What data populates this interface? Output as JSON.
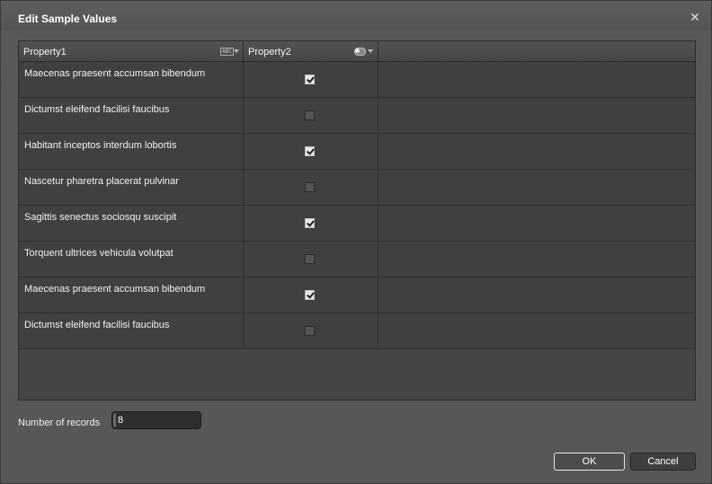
{
  "window": {
    "title": "Edit Sample Values",
    "close_glyph": "✕"
  },
  "grid": {
    "columns": [
      {
        "label": "Property1",
        "type_icon": "text-type-icon",
        "icon_text": "ABC"
      },
      {
        "label": "Property2",
        "type_icon": "boolean-toggle-icon"
      }
    ],
    "rows": [
      {
        "text": "Maecenas praesent accumsan bibendum",
        "checked": true
      },
      {
        "text": "Dictumst eleifend facilisi faucibus",
        "checked": false
      },
      {
        "text": "Habitant inceptos interdum lobortis",
        "checked": true
      },
      {
        "text": "Nascetur pharetra placerat pulvinar",
        "checked": false
      },
      {
        "text": "Sagittis senectus sociosqu suscipit",
        "checked": true
      },
      {
        "text": "Torquent ultrices vehicula volutpat",
        "checked": false
      },
      {
        "text": "Maecenas praesent accumsan bibendum",
        "checked": true
      },
      {
        "text": "Dictumst eleifend facilisi faucibus",
        "checked": false
      }
    ]
  },
  "footer": {
    "records_label": "Number of records",
    "records_value": "8"
  },
  "buttons": {
    "ok": "OK",
    "cancel": "Cancel"
  }
}
